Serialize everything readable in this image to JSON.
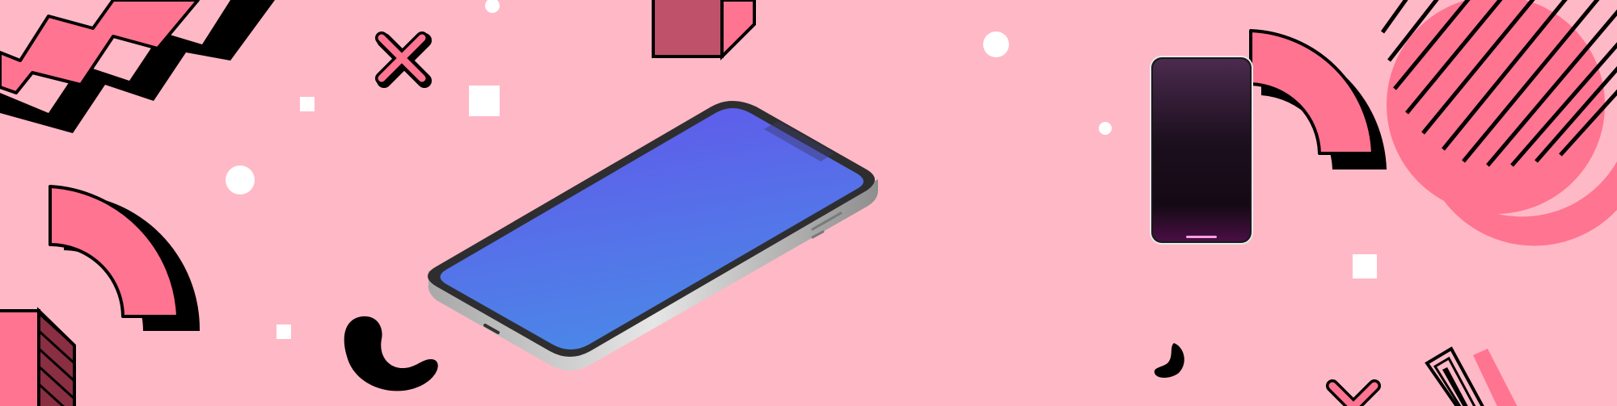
{
  "scene": {
    "description_text": "",
    "colors": {
      "background": "#FFB8C6",
      "accent_pink": "#FF7490",
      "dark_pink": "#C0516A",
      "outline": "#000000",
      "white": "#FFFFFF",
      "screen_gradient_top": "#6255EA",
      "screen_gradient_bottom": "#4C86E8",
      "phone_frame": "#2E2E30",
      "phone_side": "#BDBDBD",
      "upright_screen_top": "#4B2A4E",
      "upright_screen_bottom": "#3A0C3A"
    },
    "objects": [
      "zigzag-shape",
      "x-mark-icon",
      "dot",
      "square",
      "cube",
      "isometric-phone-mockup",
      "upright-phone-mockup",
      "quarter-arc-shape",
      "c-hook-shape",
      "striped-circle-shape",
      "striped-box-shape",
      "chevron-shape"
    ]
  }
}
